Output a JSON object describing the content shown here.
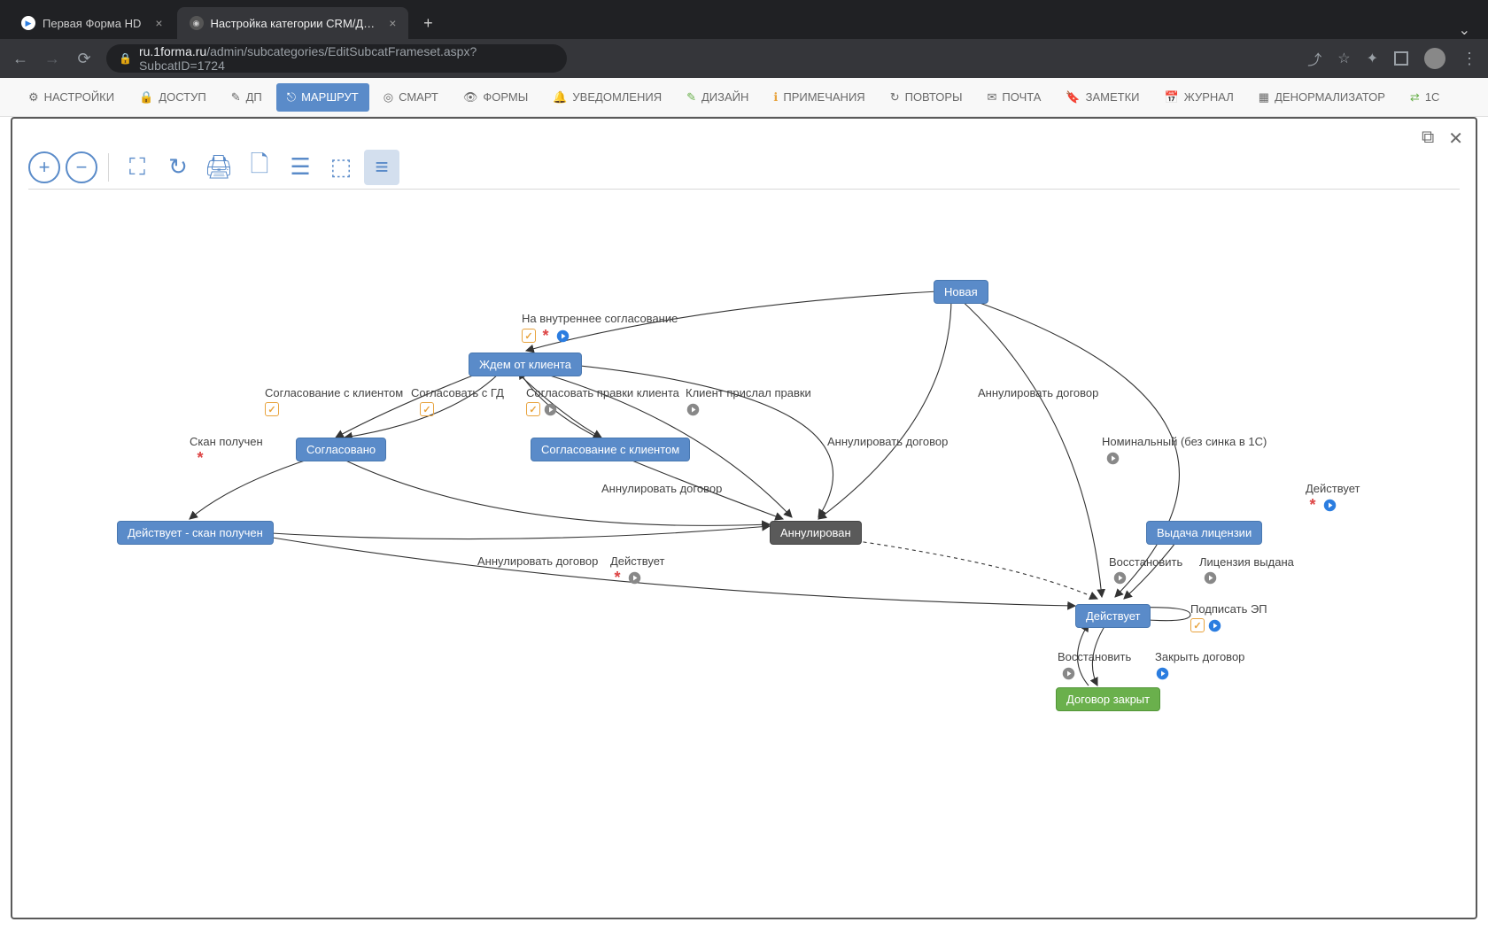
{
  "browser": {
    "tabs": [
      {
        "title": "Первая Форма HD",
        "active": false
      },
      {
        "title": "Настройка категории CRM/Д…",
        "active": true
      }
    ],
    "url_host": "ru.1forma.ru",
    "url_path": "/admin/subcategories/EditSubcatFrameset.aspx?SubcatID=1724"
  },
  "nav": {
    "items": [
      {
        "icon": "gear",
        "label": "НАСТРОЙКИ"
      },
      {
        "icon": "lock",
        "label": "ДОСТУП",
        "color": "red"
      },
      {
        "icon": "edit",
        "label": "ДП"
      },
      {
        "icon": "route",
        "label": "МАРШРУТ",
        "active": true
      },
      {
        "icon": "target",
        "label": "СМАРТ"
      },
      {
        "icon": "eye",
        "label": "ФОРМЫ"
      },
      {
        "icon": "bell",
        "label": "УВЕДОМЛЕНИЯ",
        "color": "orange"
      },
      {
        "icon": "brush",
        "label": "ДИЗАЙН",
        "color": "green"
      },
      {
        "icon": "info",
        "label": "ПРИМЕЧАНИЯ",
        "color": "orange"
      },
      {
        "icon": "repeat",
        "label": "ПОВТОРЫ"
      },
      {
        "icon": "mail",
        "label": "ПОЧТА"
      },
      {
        "icon": "bookmark",
        "label": "ЗАМЕТКИ",
        "color": "orange"
      },
      {
        "icon": "calendar",
        "label": "ЖУРНАЛ",
        "color": "red"
      },
      {
        "icon": "db",
        "label": "ДЕНОРМАЛИЗАТОР"
      },
      {
        "icon": "sync",
        "label": "1С",
        "color": "green"
      }
    ]
  },
  "nodes": {
    "novaya": "Новая",
    "zhdem": "Ждем от клиента",
    "soglasovano": "Согласовано",
    "sogl_klient": "Согласование с клиентом",
    "deistv_skan": "Действует - скан получен",
    "annulirovan": "Аннулирован",
    "vydacha": "Выдача лицензии",
    "deistvuet": "Действует",
    "zakryt": "Договор закрыт"
  },
  "edges": {
    "na_vnutr": "На внутреннее согласование",
    "sogl_s_klientom": "Согласование с клиентом",
    "sogl_s_gd": "Согласовать с ГД",
    "sogl_pravki": "Согласовать правки клиента",
    "klient_prislal": "Клиент прислал правки",
    "annul1": "Аннулировать договор",
    "skan_poluchen": "Скан получен",
    "annul2": "Аннулировать договор",
    "annul3": "Аннулировать договор",
    "nominal": "Номинальный (без синка в 1С)",
    "deistv_label": "Действует",
    "annul4": "Аннулировать договор",
    "deistv2": "Действует",
    "vosstanovit": "Восстановить",
    "lic_vydana": "Лицензия выдана",
    "podpisat": "Подписать ЭП",
    "zakryt_dog": "Закрыть договор",
    "vosstanovit2": "Восстановить"
  }
}
